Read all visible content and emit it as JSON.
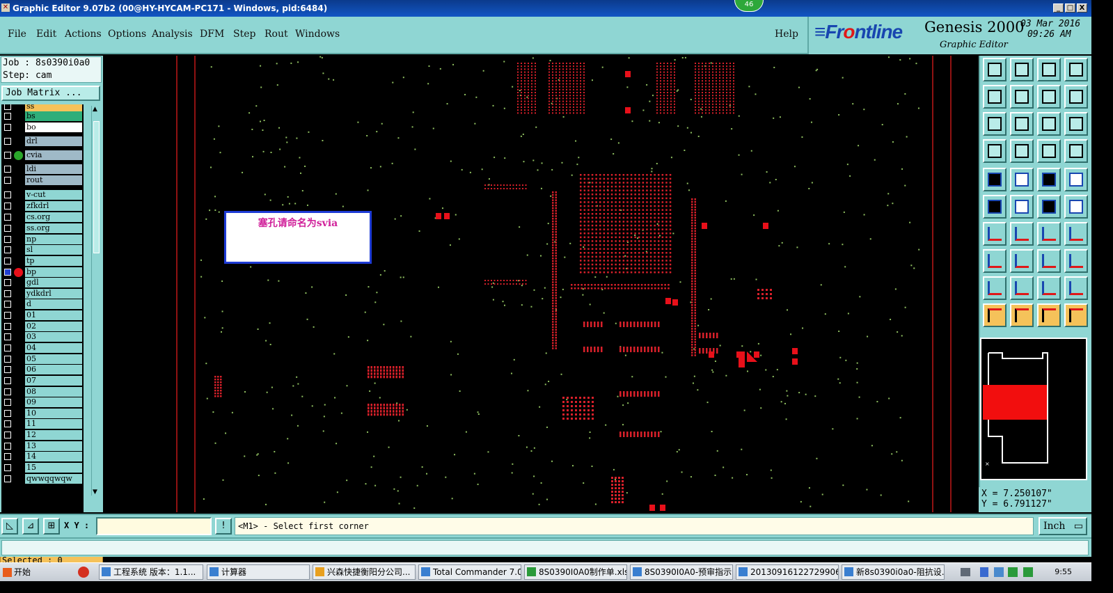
{
  "window": {
    "title": "Graphic Editor 9.07b2 (00@HY-HYCAM-PC171 - Windows, pid:6484)",
    "badge": "46",
    "min": "_",
    "max": "□",
    "close": "X"
  },
  "menu": {
    "items": [
      "File",
      "Edit",
      "Actions",
      "Options",
      "Analysis",
      "DFM",
      "Step",
      "Rout",
      "Windows"
    ],
    "help": "Help"
  },
  "brand": {
    "logo_a": "≡Fr",
    "logo_b": "o",
    "logo_c": "ntline",
    "product": "Genesis 2000",
    "subtitle": "Graphic Editor",
    "date": "03 Mar 2016",
    "time": "09:26 AM"
  },
  "job": {
    "job_line": "Job : 8s0390i0a0",
    "step_line": "Step: cam",
    "matrix_button": "Job Matrix ..."
  },
  "layers": [
    {
      "name": "ss",
      "color": "#f5c25a",
      "edit": "",
      "swatch": "#000"
    },
    {
      "name": "bs",
      "color": "#2fae7a",
      "edit": "✎",
      "swatch": "#000"
    },
    {
      "name": "bo",
      "color": "#ffffff",
      "edit": "✎",
      "swatch": "#000"
    },
    {
      "name": "drl",
      "color": "#9fb9c7",
      "edit": "",
      "swatch": "#000"
    },
    {
      "name": "cvia",
      "color": "#9fb9c7",
      "edit": "",
      "swatch": "#2aa62a"
    },
    {
      "name": "ldi",
      "color": "#9fb9c7",
      "edit": "",
      "swatch": "#000"
    },
    {
      "name": "rout",
      "color": "#9fb9c7",
      "edit": "",
      "swatch": "#000"
    },
    {
      "name": "v-cut",
      "color": "#8fd6d3",
      "edit": "",
      "swatch": "#000"
    },
    {
      "name": "zfkdrl",
      "color": "#8fd6d3",
      "edit": "",
      "swatch": "#000"
    },
    {
      "name": "cs.org",
      "color": "#8fd6d3",
      "edit": "✎",
      "swatch": "#000"
    },
    {
      "name": "ss.org",
      "color": "#8fd6d3",
      "edit": "✎",
      "swatch": "#000"
    },
    {
      "name": "np",
      "color": "#8fd6d3",
      "edit": "",
      "swatch": "#000"
    },
    {
      "name": "sl",
      "color": "#8fd6d3",
      "edit": "",
      "swatch": "#000"
    },
    {
      "name": "tp",
      "color": "#8fd6d3",
      "edit": "",
      "swatch": "#000"
    },
    {
      "name": "bp",
      "color": "#8fd6d3",
      "edit": "⊞",
      "swatch": "#e8101a"
    },
    {
      "name": "gdl",
      "color": "#8fd6d3",
      "edit": "✎",
      "swatch": "#000"
    },
    {
      "name": "ydkdrl",
      "color": "#8fd6d3",
      "edit": "",
      "swatch": "#000"
    },
    {
      "name": "d",
      "color": "#8fd6d3",
      "edit": "",
      "swatch": "#000"
    },
    {
      "name": "01",
      "color": "#8fd6d3",
      "edit": "✎",
      "swatch": "#000"
    },
    {
      "name": "02",
      "color": "#8fd6d3",
      "edit": "✎",
      "swatch": "#000"
    },
    {
      "name": "03",
      "color": "#8fd6d3",
      "edit": "✎",
      "swatch": "#000"
    },
    {
      "name": "04",
      "color": "#8fd6d3",
      "edit": "✎",
      "swatch": "#000"
    },
    {
      "name": "05",
      "color": "#8fd6d3",
      "edit": "✎",
      "swatch": "#000"
    },
    {
      "name": "06",
      "color": "#8fd6d3",
      "edit": "✎",
      "swatch": "#000"
    },
    {
      "name": "07",
      "color": "#8fd6d3",
      "edit": "✎",
      "swatch": "#000"
    },
    {
      "name": "08",
      "color": "#8fd6d3",
      "edit": "✎",
      "swatch": "#000"
    },
    {
      "name": "09",
      "color": "#8fd6d3",
      "edit": "✎",
      "swatch": "#000"
    },
    {
      "name": "10",
      "color": "#8fd6d3",
      "edit": "✎",
      "swatch": "#000"
    },
    {
      "name": "11",
      "color": "#8fd6d3",
      "edit": "✎",
      "swatch": "#000"
    },
    {
      "name": "12",
      "color": "#8fd6d3",
      "edit": "✎",
      "swatch": "#000"
    },
    {
      "name": "13",
      "color": "#8fd6d3",
      "edit": "",
      "swatch": "#000"
    },
    {
      "name": "14",
      "color": "#8fd6d3",
      "edit": "",
      "swatch": "#000"
    },
    {
      "name": "15",
      "color": "#8fd6d3",
      "edit": "✎",
      "swatch": "#000"
    },
    {
      "name": "qwwqqwqw",
      "color": "#8fd6d3",
      "edit": "",
      "swatch": "#000"
    }
  ],
  "selected": "Selected : 0",
  "annotation": "塞孔请命名为svia",
  "coords": {
    "x": "X = 7.250107\"",
    "y": "Y = 6.791127\""
  },
  "command": {
    "xy_label": "X Y :",
    "xy_value": "",
    "message": "<M1> - Select first corner",
    "units": "Inch"
  },
  "taskbar": {
    "start": "开始",
    "items": [
      "工程系统  版本：1.1...",
      "计算器",
      "兴森快捷衡阳分公司...",
      "Total Commander 7.0 p...",
      "8S0390I0A0制作单.xls...",
      "8S0390I0A0-预审指示...",
      "20130916122729906.rt...",
      "新8s0390i0a0-阻抗设..."
    ],
    "clock": "9:55"
  },
  "colors": {
    "accent": "#8fd6d3",
    "pad": "#e8101a",
    "dot": "#8fbf60",
    "frame": "#c01818"
  }
}
